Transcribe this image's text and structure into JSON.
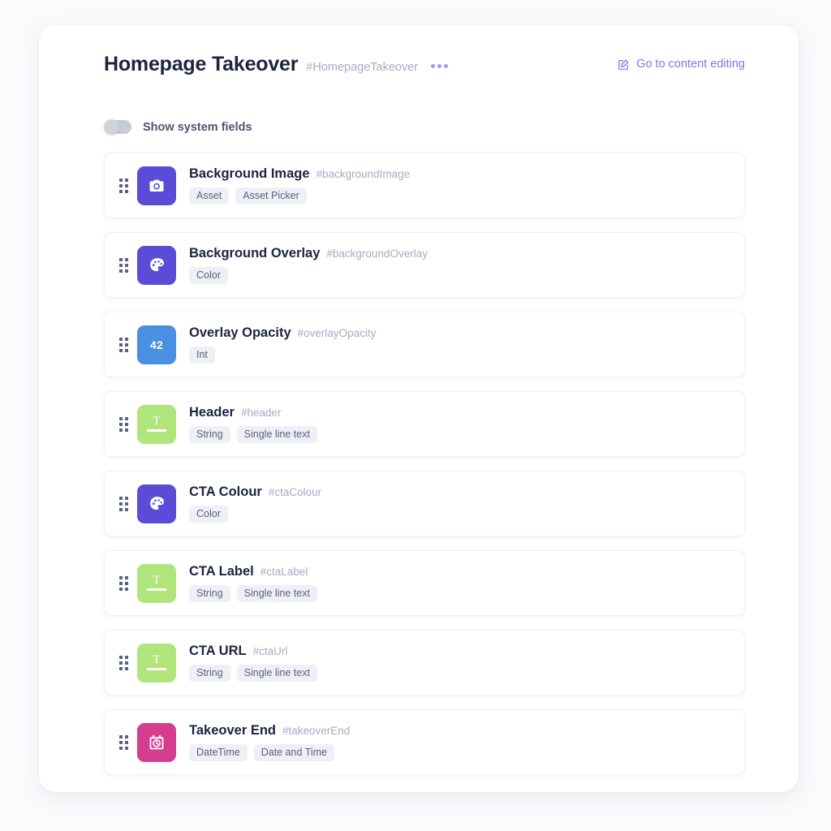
{
  "header": {
    "title": "Homepage Takeover",
    "code": "#HomepageTakeover",
    "kebab_label": "…",
    "content_edit_link": "Go to content editing"
  },
  "toggle": {
    "label": "Show system fields",
    "state": "off"
  },
  "colors": {
    "tile_purple": "#5b4bd6",
    "tile_blue": "#4a90e2",
    "tile_green": "#b0e57c",
    "tile_pink": "#d63d8e",
    "accent_link": "#7c78e8",
    "chip_bg": "#eef0f5",
    "code_text": "#a7abc0"
  },
  "fields": [
    {
      "name": "Background Image",
      "code": "#backgroundImage",
      "icon": "camera-icon",
      "tile_color": "#5b4bd6",
      "chips": [
        "Asset",
        "Asset Picker"
      ]
    },
    {
      "name": "Background Overlay",
      "code": "#backgroundOverlay",
      "icon": "palette-icon",
      "tile_color": "#5b4bd6",
      "chips": [
        "Color"
      ]
    },
    {
      "name": "Overlay Opacity",
      "code": "#overlayOpacity",
      "icon": "number-icon",
      "icon_text": "42",
      "tile_color": "#4a90e2",
      "chips": [
        "Int"
      ]
    },
    {
      "name": "Header",
      "code": "#header",
      "icon": "text-field-icon",
      "icon_text": "T",
      "tile_color": "#b0e57c",
      "chips": [
        "String",
        "Single line text"
      ]
    },
    {
      "name": "CTA Colour",
      "code": "#ctaColour",
      "icon": "palette-icon",
      "tile_color": "#5b4bd6",
      "chips": [
        "Color"
      ]
    },
    {
      "name": "CTA Label",
      "code": "#ctaLabel",
      "icon": "text-field-icon",
      "icon_text": "T",
      "tile_color": "#b0e57c",
      "chips": [
        "String",
        "Single line text"
      ]
    },
    {
      "name": "CTA URL",
      "code": "#ctaUrl",
      "icon": "text-field-icon",
      "icon_text": "T",
      "tile_color": "#b0e57c",
      "chips": [
        "String",
        "Single line text"
      ]
    },
    {
      "name": "Takeover End",
      "code": "#takeoverEnd",
      "icon": "calendar-clock-icon",
      "tile_color": "#d63d8e",
      "chips": [
        "DateTime",
        "Date and Time"
      ]
    }
  ]
}
